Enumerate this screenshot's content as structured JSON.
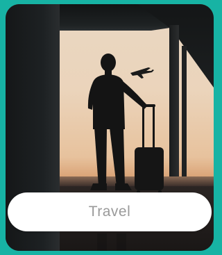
{
  "card": {
    "label": "Travel",
    "image_subject": "traveler-silhouette-icon"
  },
  "colors": {
    "page_background": "#17b3a4",
    "label_background": "#ffffff",
    "label_text": "#9a9a9a"
  }
}
